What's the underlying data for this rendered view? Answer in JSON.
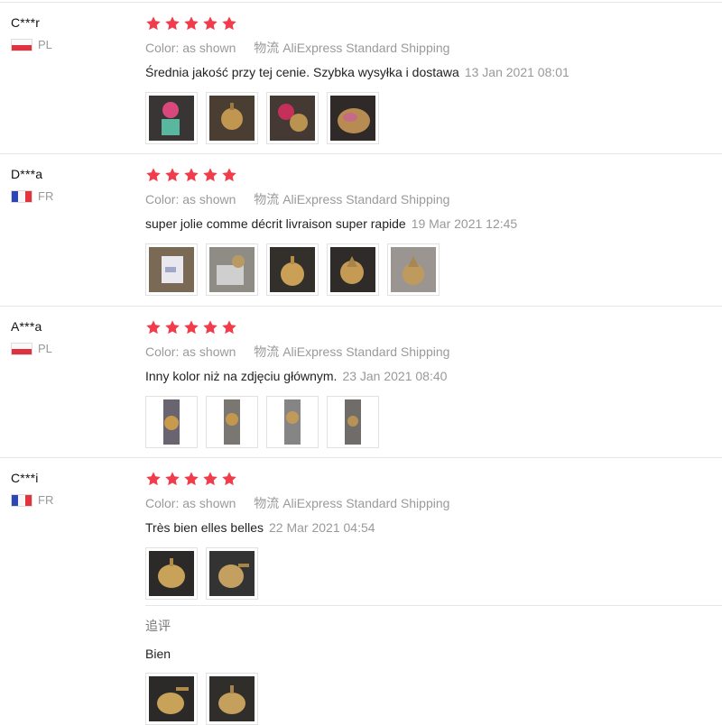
{
  "labels": {
    "color_label": "Color:",
    "shipping_label": "物流"
  },
  "colors": {
    "star": "#f03c4b",
    "muted": "#9a9a9a",
    "border": "#e6e6e6"
  },
  "reviews": [
    {
      "user": "C***r",
      "country": "PL",
      "flag": "pl",
      "stars": 5,
      "color": "as shown",
      "shipping": "AliExpress Standard Shipping",
      "text": "Średnia jakość przy tej cenie. Szybka wysyłka i dostawa",
      "date": "13 Jan 2021 08:01"
    },
    {
      "user": "D***a",
      "country": "FR",
      "flag": "fr",
      "stars": 5,
      "color": "as shown",
      "shipping": "AliExpress Standard Shipping",
      "text": "super jolie comme décrit livraison super rapide",
      "date": "19 Mar 2021 12:45"
    },
    {
      "user": "A***a",
      "country": "PL",
      "flag": "pl",
      "stars": 5,
      "color": "as shown",
      "shipping": "AliExpress Standard Shipping",
      "text": "Inny kolor niż na zdjęciu głównym.",
      "date": "23 Jan 2021 08:40"
    },
    {
      "user": "C***i",
      "country": "FR",
      "flag": "fr",
      "stars": 5,
      "color": "as shown",
      "shipping": "AliExpress Standard Shipping",
      "text": "Très bien elles belles",
      "date": "22 Mar 2021 04:54",
      "additional": {
        "title": "追评",
        "text": "Bien"
      }
    }
  ]
}
